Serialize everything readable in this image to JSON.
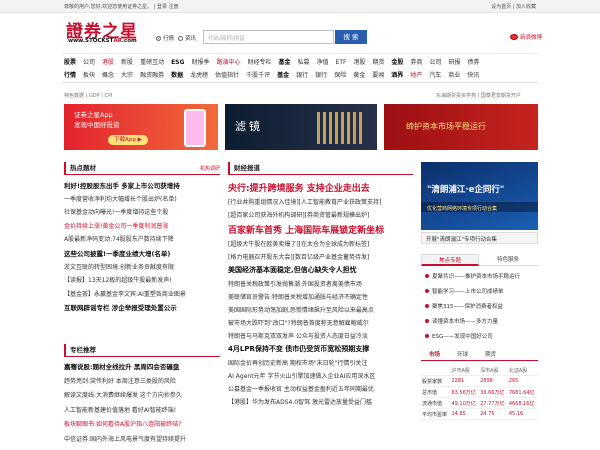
{
  "topbar": {
    "left": "尊敬的用户,您好,欢迎您使用证券之星。 | 登录  注册",
    "right": "设为首页 | 加入收藏"
  },
  "logo": {
    "cn": "證券之星",
    "en_prefix": "www.STOCKST",
    "en_accent": "AR",
    "en_suffix": ".com"
  },
  "search": {
    "option1": "行情",
    "option2": "资讯",
    "placeholder": "代码/简称/拼音",
    "button": "搜 索"
  },
  "weibo": "新浪微博",
  "nav": {
    "row1": [
      {
        "t": "股票",
        "s": "b"
      },
      {
        "t": "公司"
      },
      {
        "t": "港股",
        "s": "r"
      },
      {
        "t": "新股"
      },
      {
        "t": "重磅互动"
      },
      {
        "t": "ESG",
        "s": "b"
      },
      {
        "t": "财报季"
      },
      {
        "t": "路演中心",
        "s": "r"
      },
      {
        "t": "财经专栏"
      },
      {
        "t": "基金",
        "s": "b"
      },
      {
        "t": "私募"
      },
      {
        "t": "净值"
      },
      {
        "t": "ETF"
      },
      {
        "t": "港股"
      },
      {
        "t": "期货"
      },
      {
        "t": "金股",
        "s": "b"
      },
      {
        "t": "券商"
      },
      {
        "t": "公司"
      },
      {
        "t": "研报"
      },
      {
        "t": "债券"
      }
    ],
    "row2": [
      {
        "t": "行情",
        "s": "b"
      },
      {
        "t": "板块"
      },
      {
        "t": "概念"
      },
      {
        "t": "大宗"
      },
      {
        "t": "融资融券"
      },
      {
        "t": "数据",
        "s": "b"
      },
      {
        "t": "龙虎榜"
      },
      {
        "t": "估值指针"
      },
      {
        "t": "千股千评"
      },
      {
        "t": "基金",
        "s": "b"
      },
      {
        "t": "银行"
      },
      {
        "t": "银行"
      },
      {
        "t": "保险"
      },
      {
        "t": "黄金"
      },
      {
        "t": "要闻"
      },
      {
        "t": "酒界",
        "s": "b"
      },
      {
        "t": "地产",
        "s": "r"
      },
      {
        "t": "汽车"
      },
      {
        "t": "商业"
      },
      {
        "t": "快讯"
      }
    ]
  },
  "quote_bar": {
    "left": "特色数据 | GDP | CPI",
    "right": "东海期货投资学苑  |  国泰君安期货开户"
  },
  "banners": {
    "b1_line1": "证券之星App",
    "b1_line2": "发现中国好投资",
    "b1_button": "下载App ▶",
    "b2_text": "滤镜",
    "b3_text": "缔护资本市场平稳运行"
  },
  "hot": {
    "title": "热点题材",
    "more": "机构调研",
    "lines": [
      {
        "t": "利好!控股股东出手 多家上市公司获增持",
        "s": "b"
      },
      {
        "t": "一季度营收净利均大幅增长个股出炉(名单)"
      },
      {
        "t": "社保基金动向曝光!一季度增持这些个股"
      },
      {
        "t": "金价持续上涨!黄金公司一季度利润普涨",
        "s": "r"
      },
      {
        "t": "A股最新净码变动:74股股东户数持续下降"
      },
      {
        "t": "这些公司披露!一季度业绩大增(名单)",
        "s": "b"
      },
      {
        "t": "淤文互联的转型困境:创新业务贡献度有限"
      },
      {
        "t": "【读报】13天12板的超级牛股最新发声!"
      },
      {
        "t": "【基金荟】永赢基金李文宾:AI重塑各商业图景"
      },
      {
        "t": "互联网辟谣专栏 涉企举报受理处置公示",
        "s": "b"
      }
    ]
  },
  "column": {
    "title": "专栏推荐",
    "lines": [
      {
        "t": "嘉骞说股:题材全线拉升 黑周四会否碾盘",
        "s": "b"
      },
      {
        "t": "趋势亮剑:突传利好 本周注意三类股的风险"
      },
      {
        "t": "解读文度线:大消费继续爆发 这个方向抄参久"
      },
      {
        "t": "人工智能新基建价值落地 看好AI智能终端!"
      },
      {
        "t": "板块聊图书:如何看待A股沪指八连阳被终结?",
        "s": "r"
      },
      {
        "t": "中信证券:国内外海上风电景气度有望持续提升"
      }
    ]
  },
  "finance": {
    "title": "财经报道",
    "lines": [
      {
        "t": "央行:提升跨境服务 支持企业走出去",
        "s": "hl"
      },
      {
        "t": "[行业井购重组情况入佳境][人工智能教育产业获政策支持]"
      },
      {
        "t": "[超百家公司获海外机构调研][券商资管最新规模出炉]"
      },
      {
        "t": "百家新车首秀 上海国际车展锁定新坐标",
        "s": "hl"
      },
      {
        "t": "[超级大牛股在欧美卖爆了][在太仓为全球成为新标签]"
      },
      {
        "t": "[格力电器召开股东大会][数百亿级产业基金蓄势待发]"
      },
      {
        "t": "美国经济基本面稳定,但信心缺失令人担忧",
        "s": "hb"
      },
      {
        "t": "特朗普关税政策引发抛售潮 外国投资者离美债市场"
      },
      {
        "t": "美联储官员警告:特朗普关税增加通胀与经济不确定性"
      },
      {
        "t": "美国国际形势动荡加剧,恐慌情绪飙升至风险以来最高点"
      },
      {
        "t": "被市场大跌吓到\"改口\"?特朗普首度称无意解雇鲍威尔"
      },
      {
        "t": "特朗普与马斯克双双发声 公众与投资人态度日益冷淡"
      },
      {
        "t": "4月LPR保持不变 债市仍受货币宽松预期支撑",
        "s": "hb"
      },
      {
        "t": "国际金价再创历史新高 期权市场\"末日轮\"行情引关注"
      },
      {
        "t": "AI Agent元年 字节火山引擎加速做入企业AI应用深水区"
      },
      {
        "t": "公募基金一季报收官 主动权益基金盈利近五年同期最优"
      },
      {
        "t": "【港股】华为发布ADS4.0智驾 激光雷达放量受益门槛"
      }
    ]
  },
  "right": {
    "banner_title": "\"清朗浦江·e企同行\"",
    "banner_sub": "优化营商网络环境专项行动合集",
    "caption": "开展\"清朗浦江\"专项行动合集",
    "tab1": "焦点专题",
    "tab2": "特色服务",
    "items": [
      "夏聚共识——推护资本市场平稳运行",
      "智能学习——上市公司成绩单",
      "聚焦315——保护消费者权益",
      "读懂资本市场——多方力量",
      "ESG——发现中国好公司"
    ],
    "market_tabs": [
      "市场",
      "环球",
      "期货"
    ],
    "market_table": [
      [
        "",
        "沪市A股",
        "深市A股",
        "北证A股"
      ],
      [
        "股票家数",
        "2281",
        "2896",
        "265"
      ],
      [
        "总市值",
        "63.56万亿",
        "33.66万亿",
        "7681.64亿"
      ],
      [
        "流通市值",
        "49.10万亿",
        "27.77万亿",
        "4668.16亿"
      ],
      [
        "平均市盈率",
        "14.85",
        "24.75",
        "45.16"
      ]
    ]
  }
}
